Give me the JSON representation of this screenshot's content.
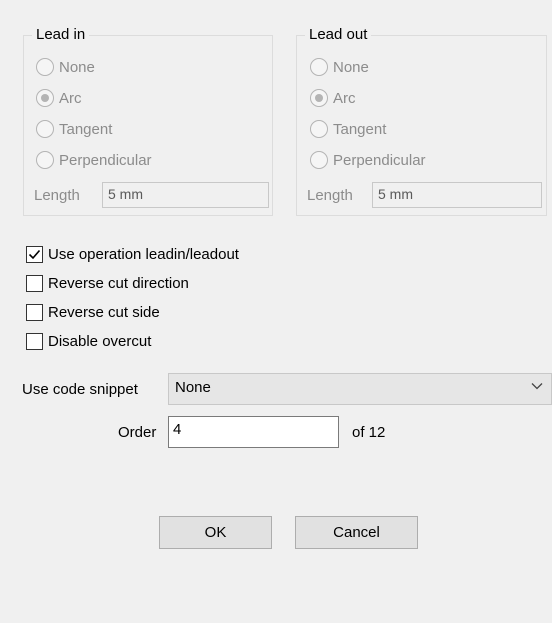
{
  "lead_in": {
    "title": "Lead in",
    "options": [
      {
        "label": "None",
        "checked": false
      },
      {
        "label": "Arc",
        "checked": true
      },
      {
        "label": "Tangent",
        "checked": false
      },
      {
        "label": "Perpendicular",
        "checked": false
      }
    ],
    "length_label": "Length",
    "length_value": "5 mm"
  },
  "lead_out": {
    "title": "Lead out",
    "options": [
      {
        "label": "None",
        "checked": false
      },
      {
        "label": "Arc",
        "checked": true
      },
      {
        "label": "Tangent",
        "checked": false
      },
      {
        "label": "Perpendicular",
        "checked": false
      }
    ],
    "length_label": "Length",
    "length_value": "5 mm"
  },
  "checkboxes": [
    {
      "label": "Use operation leadin/leadout",
      "checked": true
    },
    {
      "label": "Reverse cut direction",
      "checked": false
    },
    {
      "label": "Reverse cut side",
      "checked": false
    },
    {
      "label": "Disable overcut",
      "checked": false
    }
  ],
  "snippet": {
    "label": "Use code snippet",
    "value": "None"
  },
  "order": {
    "label": "Order",
    "value": "4",
    "of_text": "of 12"
  },
  "buttons": {
    "ok": "OK",
    "cancel": "Cancel"
  },
  "icons": {
    "dropdown": "chevron-down-icon",
    "check": "checkmark-icon"
  }
}
